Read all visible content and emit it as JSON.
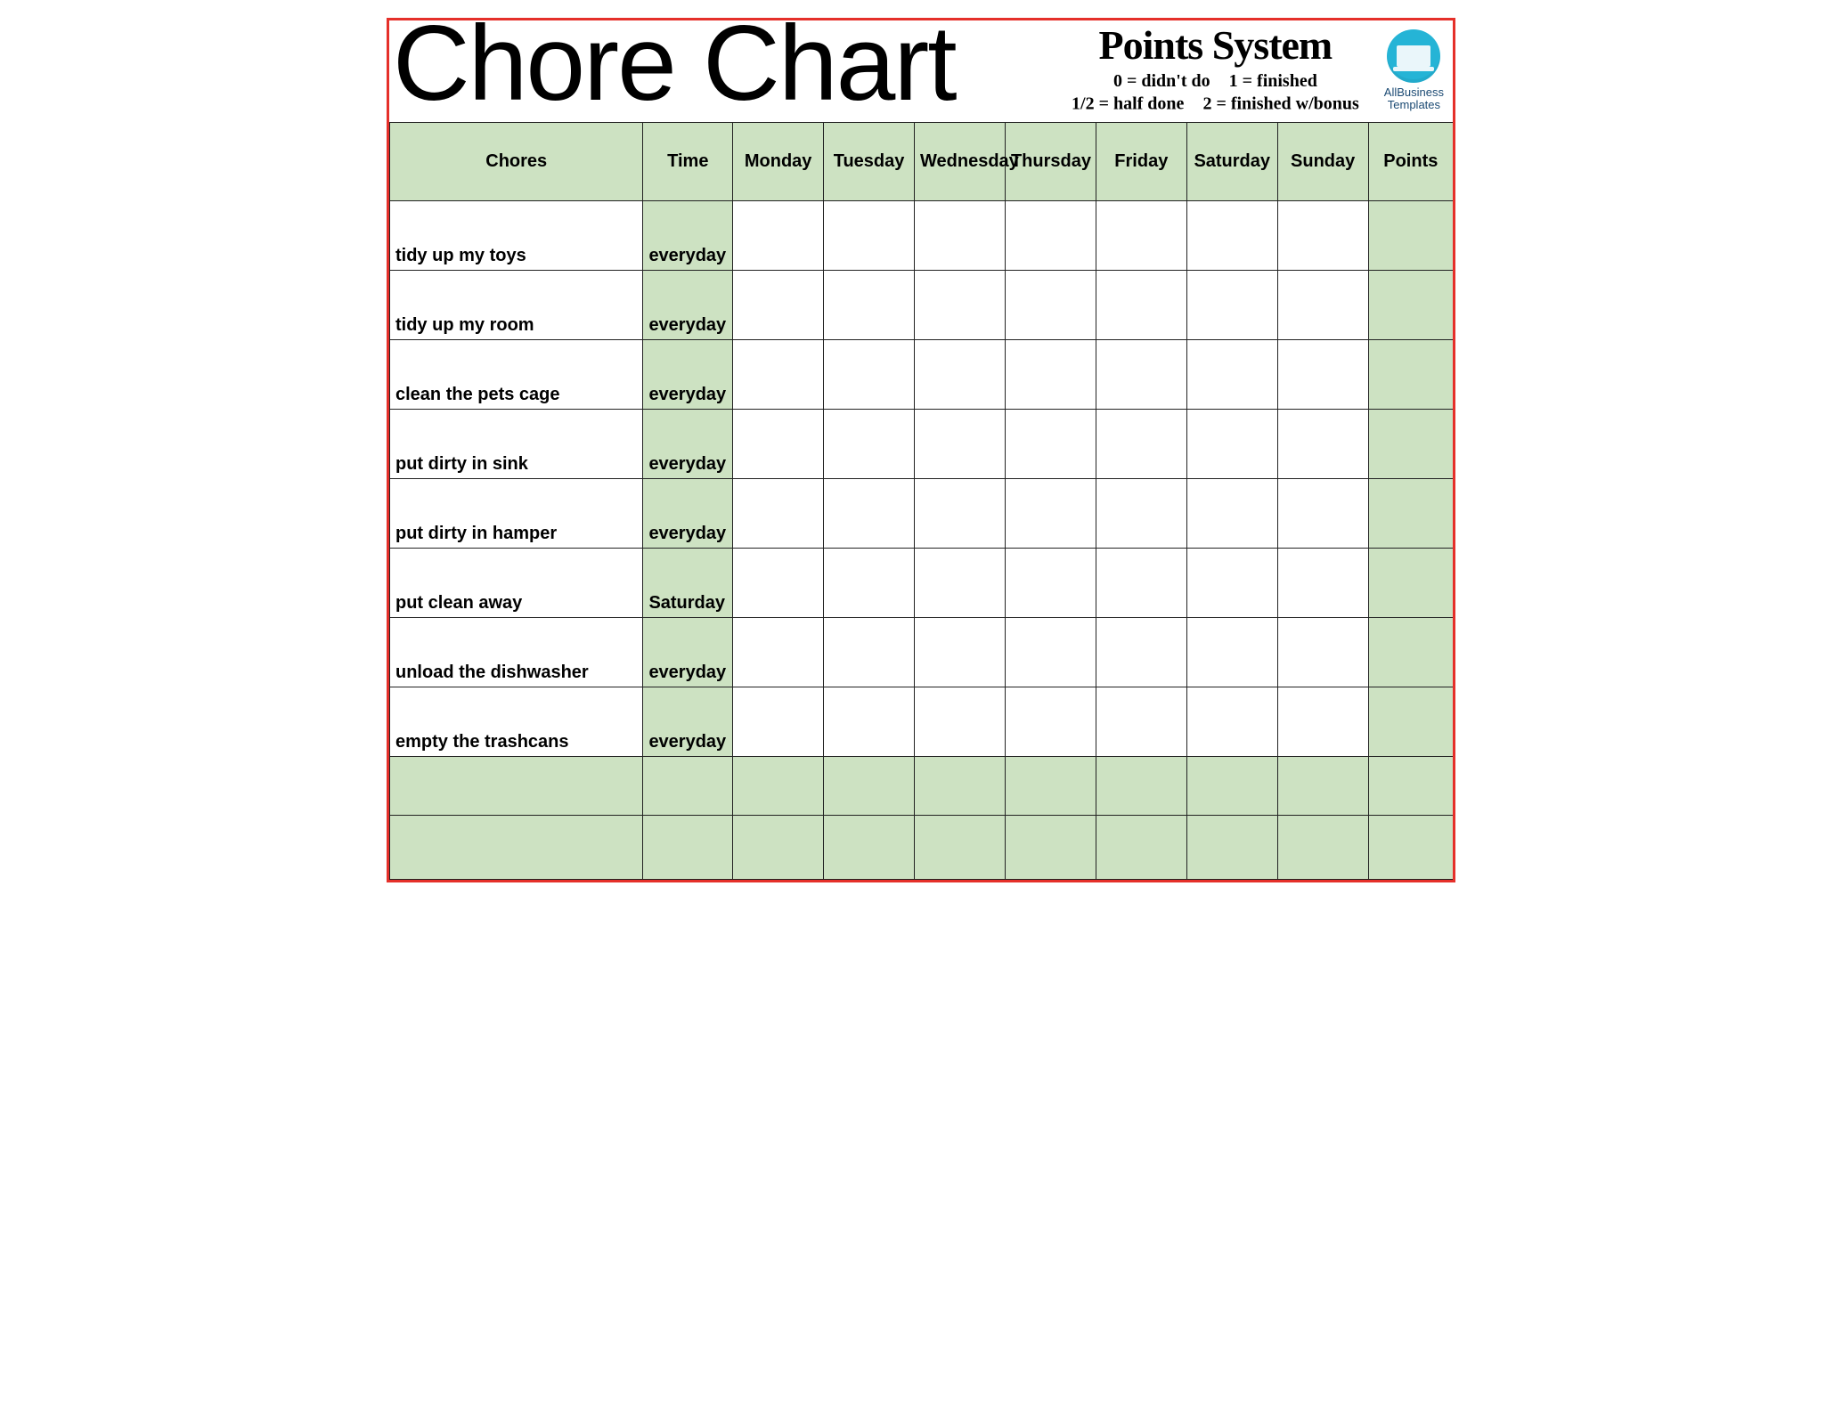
{
  "header": {
    "title": "Chore Chart",
    "points_title": "Points System",
    "legend": {
      "r1a": "0 = didn't do",
      "r1b": "1 = finished",
      "r2a": "1/2 = half done",
      "r2b": "2 = finished w/bonus"
    },
    "logo_top": "AllBusiness",
    "logo_bottom": "Templates"
  },
  "columns": {
    "chores": "Chores",
    "time": "Time",
    "days": [
      "Monday",
      "Tuesday",
      "Wednesday",
      "Thursday",
      "Friday",
      "Saturday",
      "Sunday"
    ],
    "points": "Points"
  },
  "rows": [
    {
      "chore": "tidy up my toys",
      "time": "everyday"
    },
    {
      "chore": "tidy up my room",
      "time": "everyday"
    },
    {
      "chore": "clean the pets cage",
      "time": "everyday"
    },
    {
      "chore": "put dirty in sink",
      "time": "everyday"
    },
    {
      "chore": "put dirty in hamper",
      "time": "everyday"
    },
    {
      "chore": "put clean away",
      "time": "Saturday"
    },
    {
      "chore": "unload the dishwasher",
      "time": "everyday"
    },
    {
      "chore": "empty the trashcans",
      "time": "everyday"
    }
  ],
  "chart_data": {
    "type": "table",
    "title": "Chore Chart",
    "columns": [
      "Chores",
      "Time",
      "Monday",
      "Tuesday",
      "Wednesday",
      "Thursday",
      "Friday",
      "Saturday",
      "Sunday",
      "Points"
    ],
    "rows": [
      [
        "tidy up my toys",
        "everyday",
        "",
        "",
        "",
        "",
        "",
        "",
        "",
        ""
      ],
      [
        "tidy up my room",
        "everyday",
        "",
        "",
        "",
        "",
        "",
        "",
        "",
        ""
      ],
      [
        "clean the pets cage",
        "everyday",
        "",
        "",
        "",
        "",
        "",
        "",
        "",
        ""
      ],
      [
        "put dirty in sink",
        "everyday",
        "",
        "",
        "",
        "",
        "",
        "",
        "",
        ""
      ],
      [
        "put dirty in hamper",
        "everyday",
        "",
        "",
        "",
        "",
        "",
        "",
        "",
        ""
      ],
      [
        "put clean away",
        "Saturday",
        "",
        "",
        "",
        "",
        "",
        "",
        "",
        ""
      ],
      [
        "unload the dishwasher",
        "everyday",
        "",
        "",
        "",
        "",
        "",
        "",
        "",
        ""
      ],
      [
        "empty the trashcans",
        "everyday",
        "",
        "",
        "",
        "",
        "",
        "",
        "",
        ""
      ],
      [
        "",
        "",
        "",
        "",
        "",
        "",
        "",
        "",
        "",
        ""
      ],
      [
        "",
        "",
        "",
        "",
        "",
        "",
        "",
        "",
        "",
        ""
      ]
    ],
    "points_legend": {
      "0": "didn't do",
      "1/2": "half done",
      "1": "finished",
      "2": "finished w/bonus"
    }
  }
}
